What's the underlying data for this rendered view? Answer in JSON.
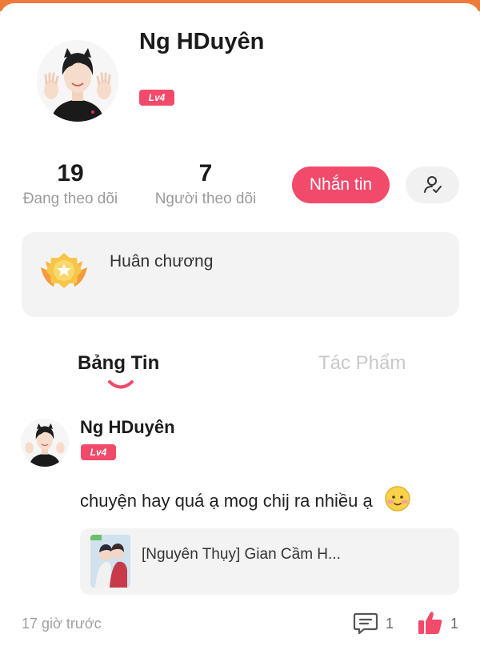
{
  "profile": {
    "name": "Ng HDuyên",
    "level": "Lv4",
    "following_count": "19",
    "following_label": "Đang theo dõi",
    "followers_count": "7",
    "followers_label": "Người theo dõi",
    "message_button": "Nhắn tin",
    "follow_icon": "user-check-icon"
  },
  "medal": {
    "label": "Huân chương",
    "icon": "medal-icon"
  },
  "tabs": [
    {
      "label": "Bảng Tin",
      "active": true
    },
    {
      "label": "Tác Phẩm",
      "active": false
    }
  ],
  "post": {
    "author": "Ng HDuyên",
    "level": "Lv4",
    "text": "chuyện hay quá ạ mog chij ra nhiều ạ",
    "emoji": "blushing-smile-emoji",
    "story_title": "[Nguyên Thụy] Gian Cầm H...",
    "time": "17 giờ trước",
    "comment_count": "1",
    "like_count": "1"
  },
  "colors": {
    "accent": "#f24a6a",
    "top_strip": "#f07a3c",
    "card_bg": "#f3f3f3"
  }
}
